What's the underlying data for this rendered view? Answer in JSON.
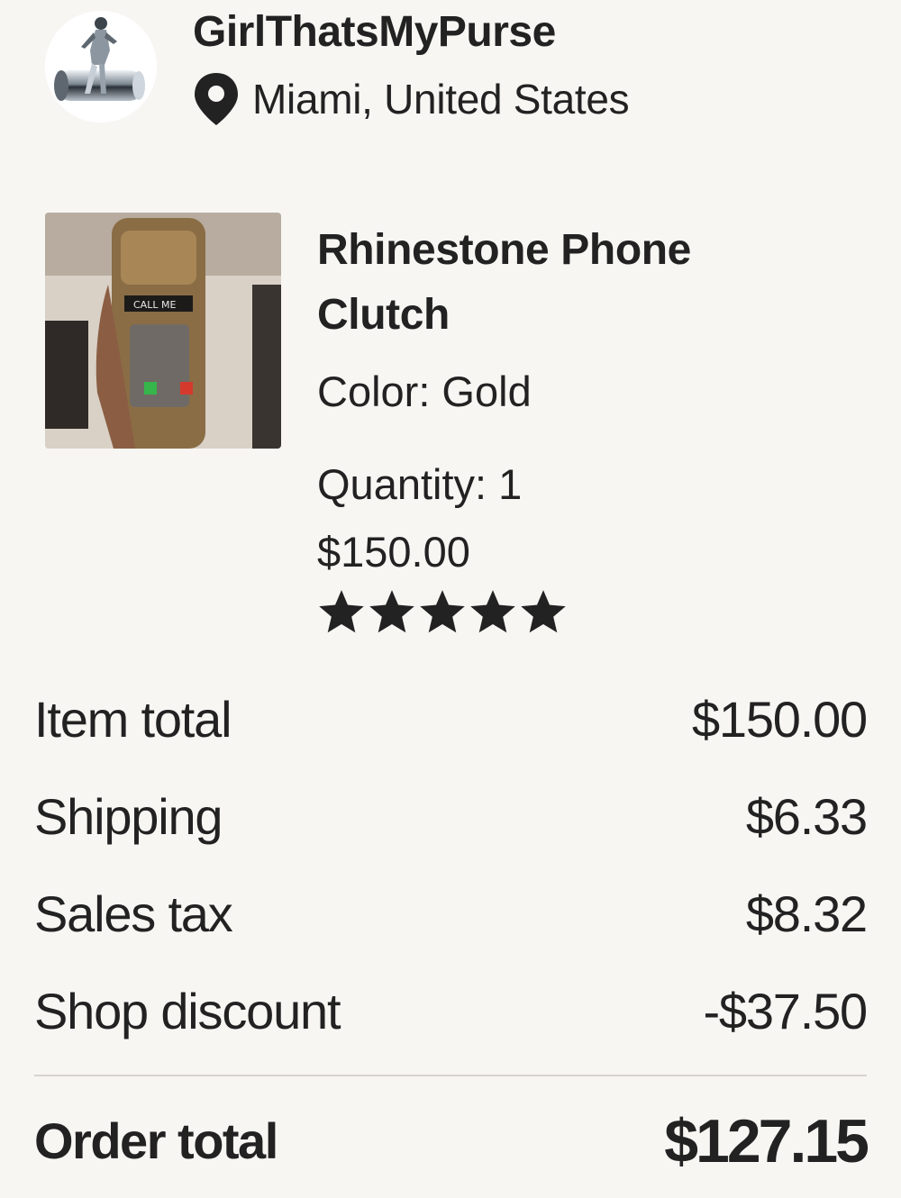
{
  "shop": {
    "name": "GirlThatsMyPurse",
    "location": "Miami, United States",
    "avatar_icon": "woman-sitting-on-silver-bag-logo",
    "location_icon": "map-pin-icon"
  },
  "item": {
    "title": "Rhinestone Phone Clutch",
    "variation": "Color: Gold",
    "quantity": "Quantity: 1",
    "price": "$150.00",
    "rating": 5,
    "rating_max": 5,
    "thumbnail_icon": "gold-rhinestone-phone-clutch-photo",
    "thumbnail_caption": "CALL ME"
  },
  "summary": {
    "rows": [
      {
        "label": "Item total",
        "value": "$150.00"
      },
      {
        "label": "Shipping",
        "value": "$6.33"
      },
      {
        "label": "Sales tax",
        "value": "$8.32"
      },
      {
        "label": "Shop discount",
        "value": "-$37.50"
      }
    ],
    "total": {
      "label": "Order total",
      "value": "$127.15"
    }
  },
  "colors": {
    "background": "#f7f6f3",
    "text": "#222222",
    "divider": "#d6d4cf"
  }
}
